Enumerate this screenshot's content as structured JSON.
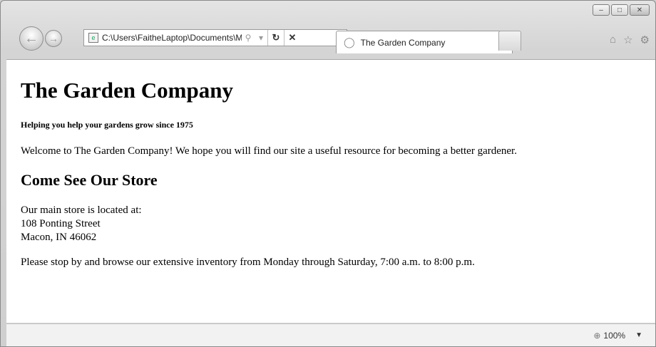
{
  "browser": {
    "address_url": "C:\\Users\\FaitheLaptop\\Documents\\M",
    "tab_title": "The Garden Company",
    "zoom": "100%"
  },
  "page": {
    "heading": "The Garden Company",
    "tagline": "Helping you help your gardens grow since 1975",
    "welcome": "Welcome to The Garden Company! We hope you will find our site a useful resource for becoming a better gardener.",
    "subheading": "Come See Our Store",
    "address_intro": "Our main store is located at:",
    "address_street": "108 Ponting Street",
    "address_city": "Macon, IN 46062",
    "hours": "Please stop by and browse our extensive inventory from Monday through Saturday, 7:00 a.m. to 8:00 p.m."
  }
}
